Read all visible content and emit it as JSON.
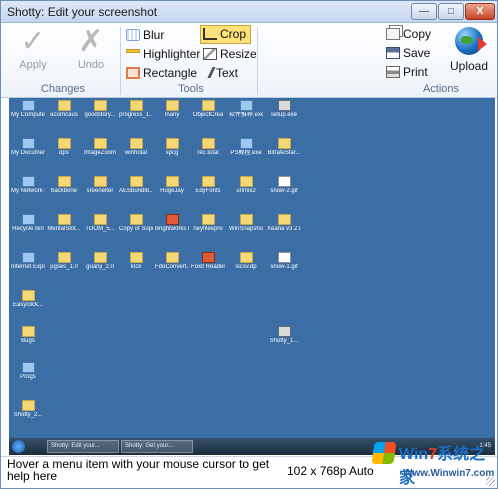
{
  "window": {
    "title": "Shotty: Edit your screenshot",
    "min_label": "—",
    "max_label": "□",
    "close_label": "X"
  },
  "ribbon": {
    "changes": {
      "apply_label": "Apply",
      "undo_label": "Undo",
      "group_label": "Changes"
    },
    "tools": {
      "blur_label": "Blur",
      "highlighter_label": "Highlighter",
      "rectangle_label": "Rectangle",
      "crop_label": "Crop",
      "resize_label": "Resize",
      "text_label": "Text",
      "group_label": "Tools",
      "active_tool": "Crop"
    },
    "actions": {
      "copy_label": "Copy",
      "save_label": "Save",
      "print_label": "Print",
      "upload_label": "Upload",
      "group_label": "Actions"
    }
  },
  "desktop": {
    "icons": [
      {
        "label": "My Computer",
        "kind": "prog"
      },
      {
        "label": "acorncaus",
        "kind": "folder"
      },
      {
        "label": "goodstory...",
        "kind": "folder"
      },
      {
        "label": "progress_1...",
        "kind": "folder"
      },
      {
        "label": "many",
        "kind": "folder"
      },
      {
        "label": "ObjectCrea",
        "kind": "folder"
      },
      {
        "label": "软件推荐.exe",
        "kind": "prog"
      },
      {
        "label": "setup.exe",
        "kind": "app"
      },
      {
        "label": "My Documents",
        "kind": "prog"
      },
      {
        "label": "dps",
        "kind": "folder"
      },
      {
        "label": "ImageZoom",
        "kind": "folder"
      },
      {
        "label": "winhotal",
        "kind": "folder"
      },
      {
        "label": "spcg",
        "kind": "folder"
      },
      {
        "label": "rec.total",
        "kind": "folder"
      },
      {
        "label": "PS教程.exe",
        "kind": "prog"
      },
      {
        "label": "BitrateStar...",
        "kind": "folder"
      },
      {
        "label": "My Network Places",
        "kind": "prog"
      },
      {
        "label": "backbone",
        "kind": "folder"
      },
      {
        "label": "sreeneiter",
        "kind": "folder"
      },
      {
        "label": "AESbundl8...",
        "kind": "folder"
      },
      {
        "label": "HugeJay",
        "kind": "folder"
      },
      {
        "label": "EdyFonts",
        "kind": "folder"
      },
      {
        "label": "urlmix2",
        "kind": "folder"
      },
      {
        "label": "snow-2.gif",
        "kind": "gif"
      },
      {
        "label": "Recycle Bin",
        "kind": "prog"
      },
      {
        "label": "MentalSlot...",
        "kind": "folder"
      },
      {
        "label": "TOOM_5...",
        "kind": "folder"
      },
      {
        "label": "Copy of Superform",
        "kind": "folder"
      },
      {
        "label": "Brightworks HTML Edi...",
        "kind": "red"
      },
      {
        "label": "neyfileepro",
        "kind": "folder"
      },
      {
        "label": "WinSnapshot",
        "kind": "folder"
      },
      {
        "label": "Xeana v3.2.0.1",
        "kind": "folder"
      },
      {
        "label": "Internet Explorer",
        "kind": "prog"
      },
      {
        "label": "pgses_1.0",
        "kind": "folder"
      },
      {
        "label": "guanji_2.0",
        "kind": "folder"
      },
      {
        "label": "lock",
        "kind": "folder"
      },
      {
        "label": "FdoConvert...",
        "kind": "folder"
      },
      {
        "label": "Foxit Reader",
        "kind": "red"
      },
      {
        "label": "sicsv.dp",
        "kind": "folder"
      },
      {
        "label": "snow-1.gif",
        "kind": "gif"
      },
      {
        "label": "Easyclick...",
        "kind": "folder"
      },
      {
        "label": "Bugs",
        "kind": "folder"
      },
      {
        "label": "Shotty_1...",
        "kind": "app"
      },
      {
        "label": "Progs",
        "kind": "prog"
      },
      {
        "label": "Shotty_2...",
        "kind": "folder"
      }
    ],
    "taskbar": {
      "task1": "Shotty: Edit your...",
      "task2": "Shotty: Get your...",
      "tray": "1:45"
    }
  },
  "status": {
    "message": "Hover a menu item with your mouse cursor to get help here",
    "dimensions": "102 x 768p",
    "zoom": "Auto"
  },
  "watermark": {
    "brand_a": "Win",
    "brand_b": "7",
    "brand_c": "系统之家",
    "url": "Www.Winwin7.com"
  }
}
